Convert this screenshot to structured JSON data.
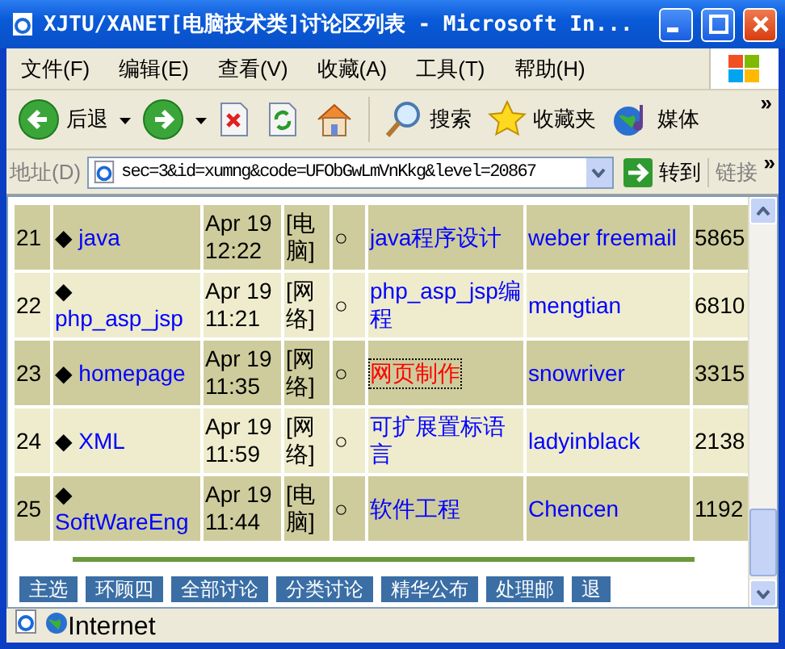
{
  "window": {
    "title": "XJTU/XANET[电脑技术类]讨论区列表 - Microsoft In..."
  },
  "menu": [
    {
      "label": "文件(F)"
    },
    {
      "label": "编辑(E)"
    },
    {
      "label": "查看(V)"
    },
    {
      "label": "收藏(A)"
    },
    {
      "label": "工具(T)"
    },
    {
      "label": "帮助(H)"
    }
  ],
  "toolbar": {
    "buttons": [
      {
        "kind": "back",
        "label": "后退",
        "dropdown": true
      },
      {
        "kind": "forward",
        "dropdown": true
      },
      {
        "kind": "stop"
      },
      {
        "kind": "refresh"
      },
      {
        "kind": "home"
      },
      {
        "kind": "search",
        "label": "搜索"
      },
      {
        "kind": "favorites",
        "label": "收藏夹"
      },
      {
        "kind": "media",
        "label": "媒体"
      }
    ],
    "more": "»"
  },
  "address": {
    "label": "地址(D)",
    "value": "sec=3&id=xumng&code=UFObGwLmVnKkg&level=20867",
    "go": "转到",
    "links": "链接",
    "more": "»"
  },
  "table": {
    "rows": [
      {
        "num": "21",
        "marker": "◆",
        "board": "java",
        "time": "Apr 19 12:22",
        "category": "[电脑]",
        "status": "○",
        "title": "java程序设计",
        "focused": false,
        "moderator": "weber freemail",
        "count": "5865"
      },
      {
        "num": "22",
        "marker": "◆",
        "board": "php_asp_jsp",
        "time": "Apr 19 11:21",
        "category": "[网络]",
        "status": "○",
        "title": "php_asp_jsp编程",
        "focused": false,
        "moderator": "mengtian",
        "count": "6810"
      },
      {
        "num": "23",
        "marker": "◆",
        "board": "homepage",
        "time": "Apr 19 11:35",
        "category": "[网络]",
        "status": "○",
        "title": "网页制作",
        "focused": true,
        "moderator": "snowriver",
        "count": "3315"
      },
      {
        "num": "24",
        "marker": "◆",
        "board": "XML",
        "time": "Apr 19 11:59",
        "category": "[网络]",
        "status": "○",
        "title": "可扩展置标语言",
        "focused": false,
        "moderator": "ladyinblack",
        "count": "2138"
      },
      {
        "num": "25",
        "marker": "◆",
        "board": "SoftWareEng",
        "time": "Apr 19 11:44",
        "category": "[电脑]",
        "status": "○",
        "title": "软件工程",
        "focused": false,
        "moderator": "Chencen",
        "count": "1192"
      }
    ]
  },
  "nav": [
    "主选",
    "环顾四",
    "全部讨论",
    "分类讨论",
    "精华公布",
    "处理邮",
    "退"
  ],
  "status_bar": {
    "zone": "Internet"
  }
}
